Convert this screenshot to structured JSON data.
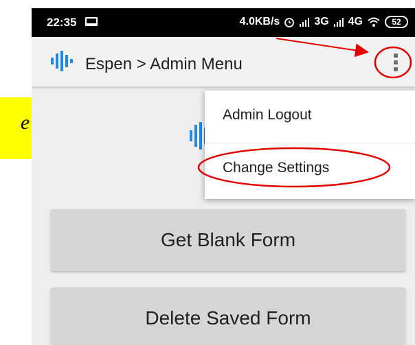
{
  "annotation_label": "e",
  "status_bar": {
    "time": "22:35",
    "net_speed": "4.0KB/s",
    "signal_text": "3G",
    "signal_text_2": "4G",
    "battery": "52"
  },
  "app_bar": {
    "title": "Espen > Admin Menu"
  },
  "overflow_menu": {
    "items": [
      "Admin Logout",
      "Change Settings"
    ]
  },
  "main": {
    "buttons": [
      "Get Blank Form",
      "Delete Saved Form"
    ]
  },
  "colors": {
    "logo_blue": "#1e88e5",
    "annotation_red": "#e00000",
    "label_yellow": "#ffff00"
  }
}
